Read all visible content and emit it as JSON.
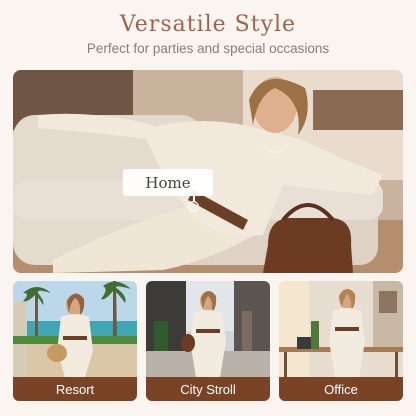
{
  "header": {
    "title": "Versatile Style",
    "subtitle": "Perfect for parties and special occasions"
  },
  "hero": {
    "tag_label": "Home"
  },
  "cards": [
    {
      "label": "Resort"
    },
    {
      "label": "City Stroll"
    },
    {
      "label": "Office"
    }
  ],
  "colors": {
    "title": "#a0634a",
    "subtitle": "#8a7d76",
    "label_bar": "#7a4326",
    "background": "#fbf5f1"
  }
}
